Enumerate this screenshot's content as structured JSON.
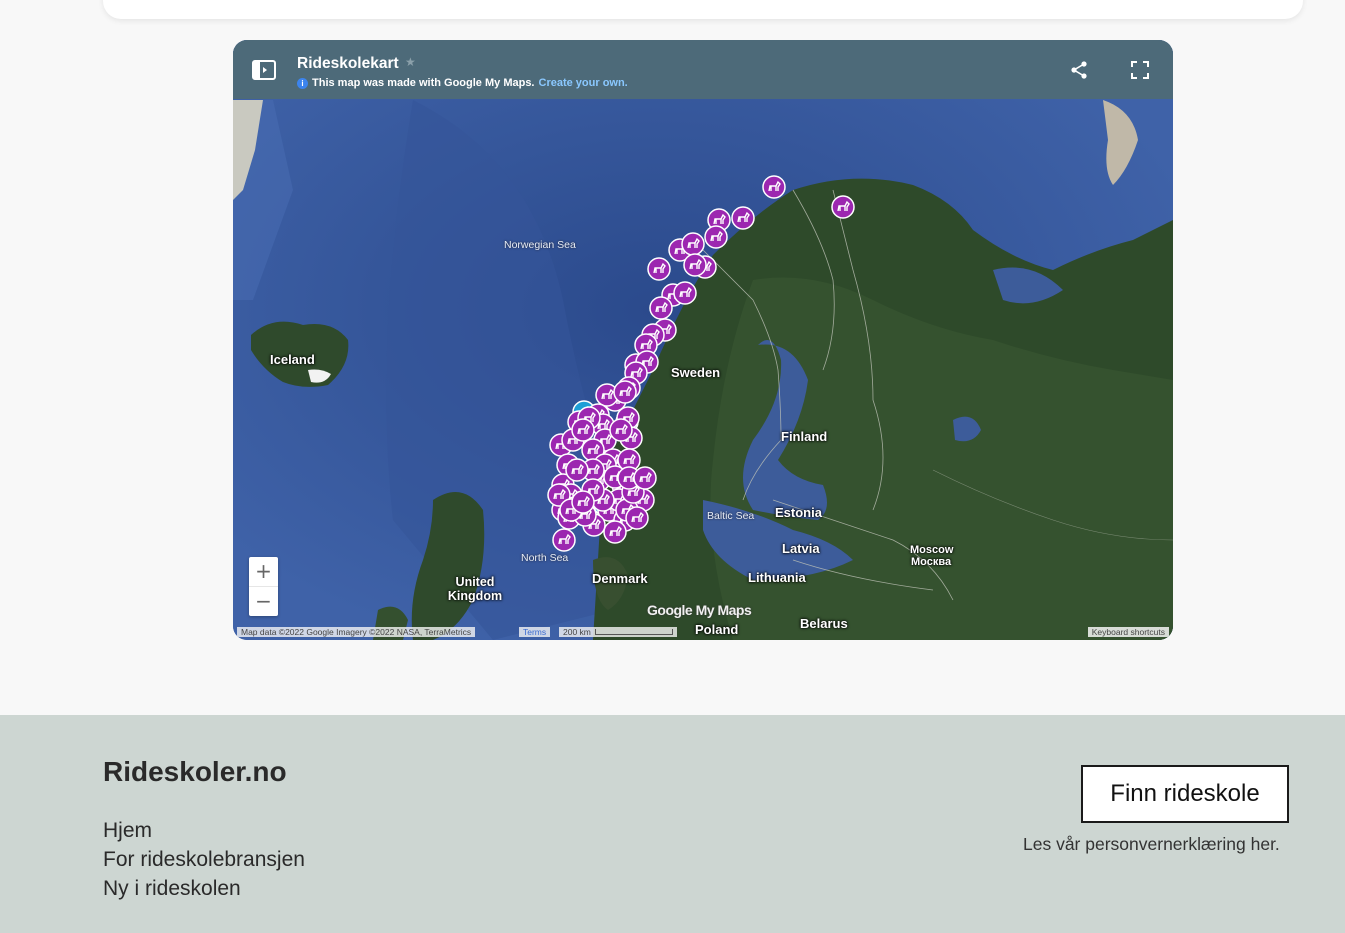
{
  "map": {
    "title": "Rideskolekart",
    "subtitle": "This map was made with Google My Maps.",
    "create_link": "Create your own.",
    "zoom_in": "+",
    "zoom_out": "−",
    "logo": "Google My Maps",
    "attribution": "Map data ©2022 Google Imagery ©2022 NASA, TerraMetrics",
    "terms": "Terms",
    "scale": "200 km",
    "keyboard": "Keyboard shortcuts",
    "labels": {
      "norwegian_sea": "Norwegian Sea",
      "iceland": "Iceland",
      "sweden": "Sweden",
      "finland": "Finland",
      "baltic_sea": "Baltic Sea",
      "estonia": "Estonia",
      "latvia": "Latvia",
      "lithuania": "Lithuania",
      "north_sea": "North Sea",
      "denmark": "Denmark",
      "united_kingdom": "United Kingdom",
      "moscow": "Moscow",
      "moscow_ru": "Москва",
      "poland": "Poland",
      "belarus": "Belarus"
    },
    "icons": {
      "marker": "horse-marker-icon",
      "share": "share-icon",
      "fullscreen": "fullscreen-icon",
      "legend": "legend-toggle-icon",
      "star": "star-icon",
      "info": "info-icon"
    },
    "colors": {
      "marker": "#9c27b0",
      "marker_alt": "#1e9fd6",
      "header": "#4d6a79"
    }
  },
  "footer": {
    "brand": "Rideskoler.no",
    "links": [
      "Hjem",
      "For rideskolebransjen",
      "Ny i rideskolen"
    ],
    "find_button": "Finn rideskole",
    "privacy": "Les vår personvernerklæring her."
  }
}
